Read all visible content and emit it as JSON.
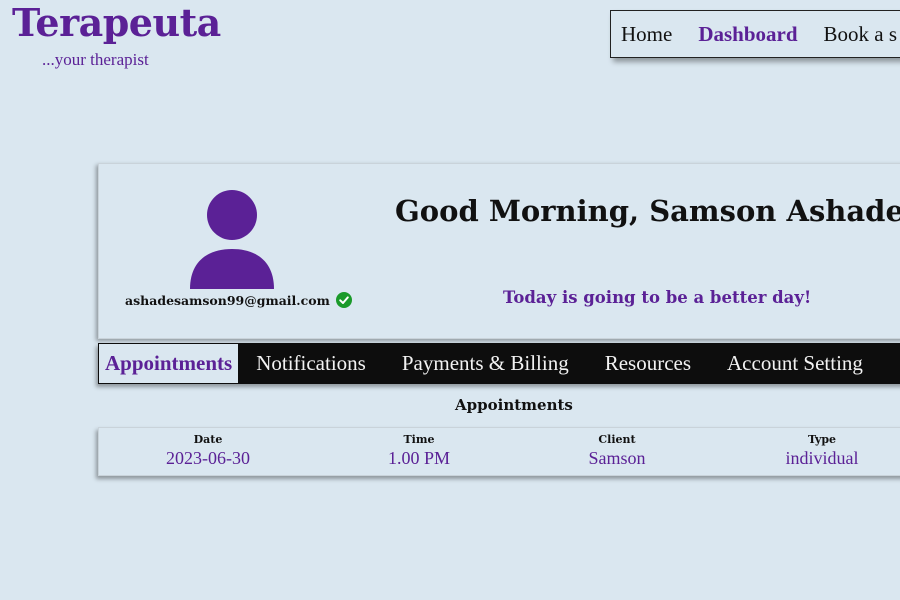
{
  "brand": {
    "title": "Terapeuta",
    "tagline": "...your therapist"
  },
  "topnav": {
    "items": [
      "Home",
      "Dashboard",
      "Book a s"
    ],
    "active": "Dashboard"
  },
  "profile": {
    "email": "ashadesamson99@gmail.com",
    "greeting": "Good Morning, Samson Ashade.",
    "subline": "Today is going to be a better day!",
    "avatar_icon": "user-avatar-icon",
    "verified_icon": "verified-check-icon"
  },
  "tabs": {
    "items": [
      "Appointments",
      "Notifications",
      "Payments & Billing",
      "Resources",
      "Account Setting"
    ],
    "active": "Appointments"
  },
  "appointments": {
    "title": "Appointments",
    "columns": [
      "Date",
      "Time",
      "Client",
      "Type"
    ],
    "rows": [
      [
        "2023-06-30",
        "1.00 PM",
        "Samson",
        "individual"
      ]
    ]
  },
  "colors": {
    "background": "#dae7f0",
    "accent": "#5b2196",
    "tab_bar": "#0d0d0d",
    "verified": "#1a9a2a"
  }
}
